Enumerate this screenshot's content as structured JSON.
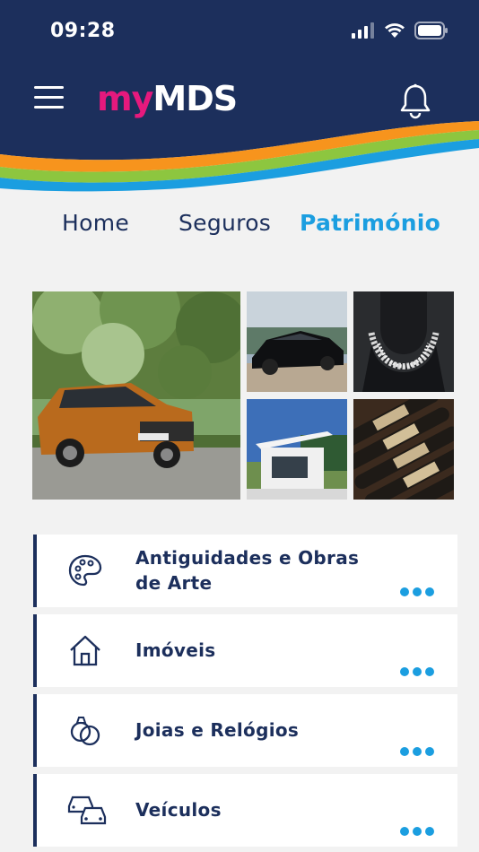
{
  "status_bar": {
    "time": "09:28"
  },
  "header": {
    "logo_my": "my",
    "logo_mds": "MDS"
  },
  "tabs": [
    {
      "label": "Home",
      "active": false
    },
    {
      "label": "Seguros",
      "active": false
    },
    {
      "label": "Património",
      "active": true
    }
  ],
  "photos": [
    "orange-suv-photo",
    "black-sports-car-photo",
    "diamond-necklace-photo",
    "modern-house-photo",
    "wine-bottles-photo"
  ],
  "categories": [
    {
      "label_line1": "Antiguidades e Obras",
      "label_line2": "de Arte",
      "icon": "palette-icon"
    },
    {
      "label_line1": "Imóveis",
      "icon": "house-icon"
    },
    {
      "label_line1": "Joias e Relógios",
      "icon": "rings-icon"
    },
    {
      "label_line1": "Veículos",
      "icon": "cars-icon"
    }
  ],
  "colors": {
    "navy": "#1c2f5c",
    "accent_blue": "#1b9ee0",
    "brand_pink": "#e6197d",
    "stripe_orange": "#f7941d",
    "stripe_green": "#8dc63f",
    "stripe_blue": "#1b9ee0"
  }
}
